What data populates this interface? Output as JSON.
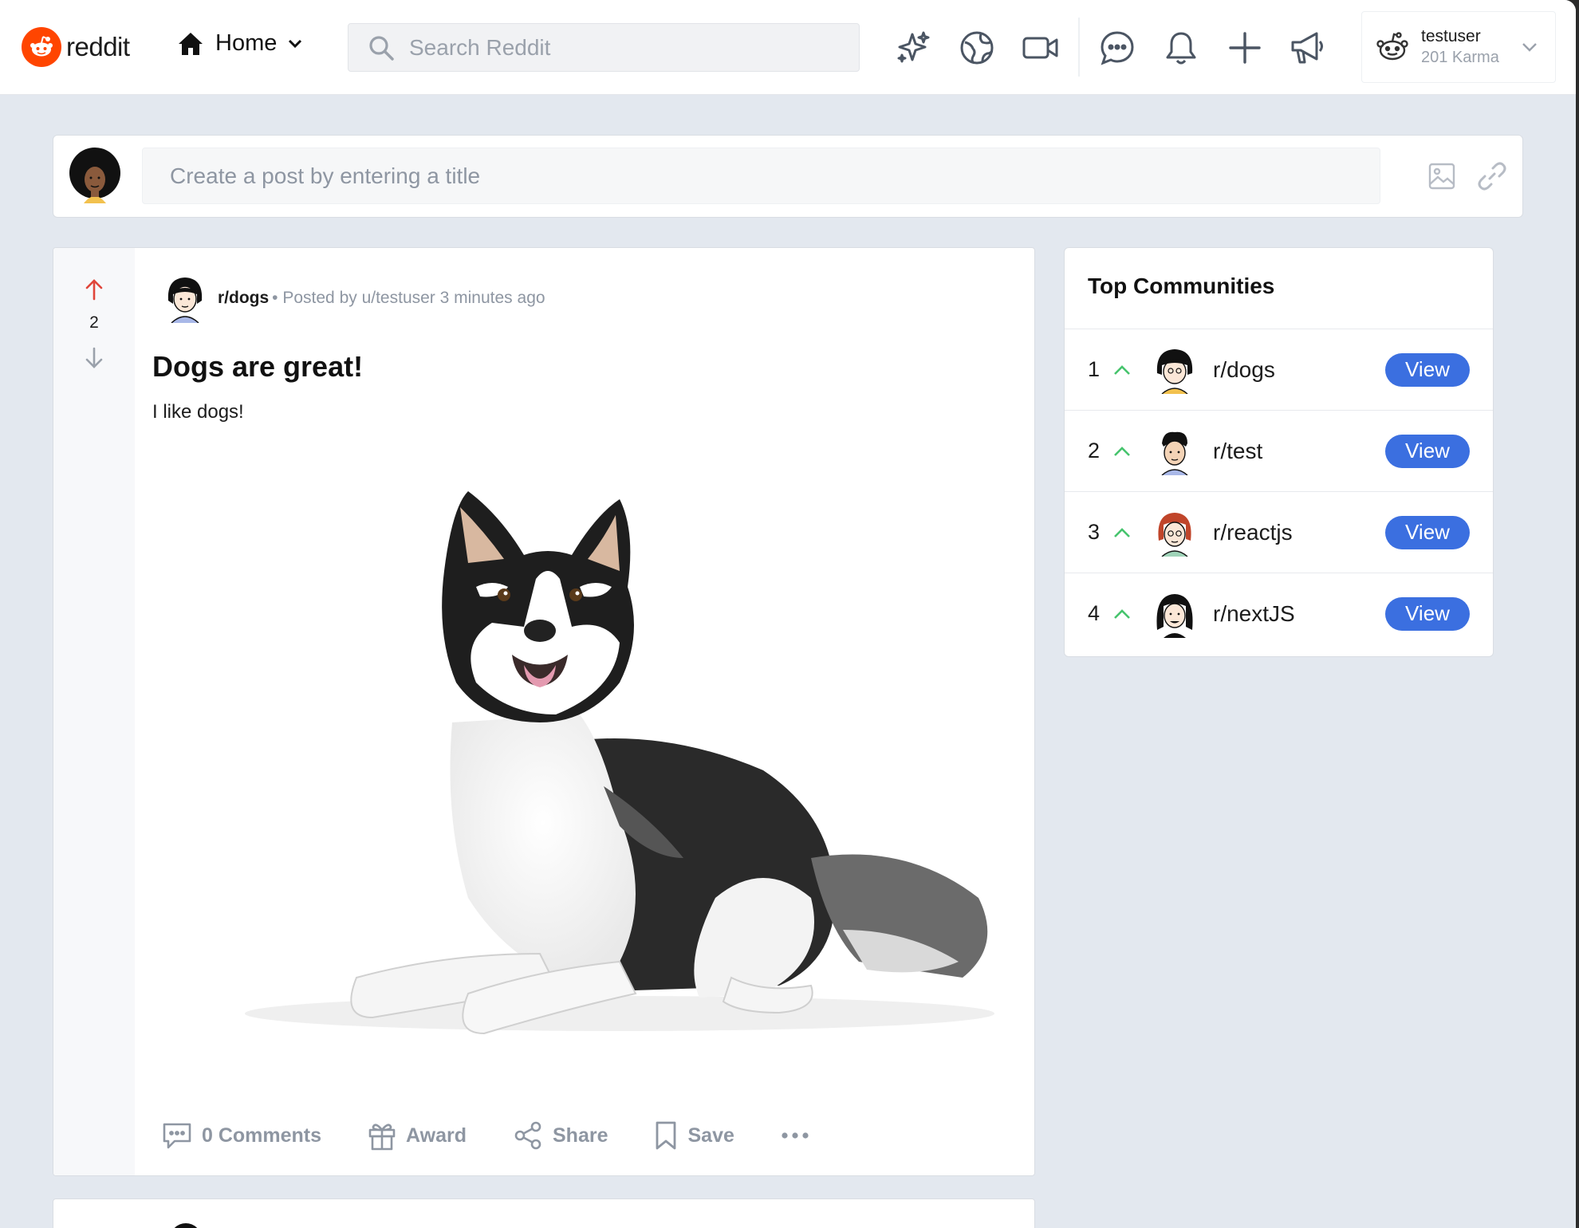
{
  "header": {
    "logo_text": "reddit",
    "home_label": "Home",
    "search_placeholder": "Search Reddit",
    "user": {
      "name": "testuser",
      "karma": "201 Karma"
    },
    "icons": [
      "sparkle-icon",
      "globe-icon",
      "video-icon",
      "chat-icon",
      "bell-icon",
      "plus-icon",
      "megaphone-icon"
    ]
  },
  "create_post": {
    "placeholder": "Create a post by entering a title"
  },
  "post": {
    "subreddit": "r/dogs",
    "meta": "• Posted by u/testuser 3 minutes ago",
    "score": "2",
    "title": "Dogs are great!",
    "body": "I like dogs!",
    "actions": {
      "comments": "0 Comments",
      "award": "Award",
      "share": "Share",
      "save": "Save"
    }
  },
  "sidebar": {
    "title": "Top Communities",
    "communities": [
      {
        "rank": "1",
        "name": "r/dogs",
        "button": "View"
      },
      {
        "rank": "2",
        "name": "r/test",
        "button": "View"
      },
      {
        "rank": "3",
        "name": "r/reactjs",
        "button": "View"
      },
      {
        "rank": "4",
        "name": "r/nextJS",
        "button": "View"
      }
    ]
  },
  "colors": {
    "accent": "#3b6fe0",
    "brand": "#ff4500",
    "upvote": "#e0453a",
    "trend": "#46c46d"
  }
}
